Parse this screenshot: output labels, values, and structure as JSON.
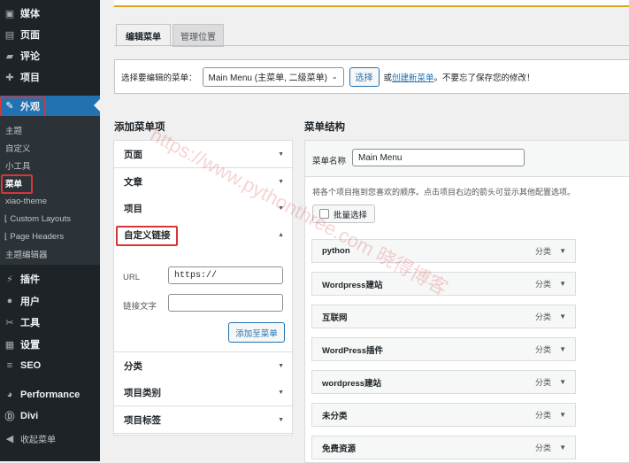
{
  "sidebar": {
    "top_items": [
      {
        "label": "媒体",
        "icon": "media-icon"
      },
      {
        "label": "页面",
        "icon": "page-icon"
      },
      {
        "label": "评论",
        "icon": "comment-icon"
      },
      {
        "label": "项目",
        "icon": "project-icon"
      }
    ],
    "active_item": {
      "label": "外观",
      "icon": "appearance-icon"
    },
    "submenu": [
      "主题",
      "自定义",
      "小工具",
      "菜单",
      "xiao-theme",
      "Custom Layouts",
      "Page Headers",
      "主题编辑器"
    ],
    "bottom_items": [
      {
        "label": "插件",
        "icon": "plugin-icon"
      },
      {
        "label": "用户",
        "icon": "user-icon"
      },
      {
        "label": "工具",
        "icon": "tool-icon"
      },
      {
        "label": "设置",
        "icon": "settings-icon"
      },
      {
        "label": "SEO",
        "icon": "seo-icon"
      },
      {
        "label": "Performance",
        "icon": "performance-icon"
      },
      {
        "label": "Divi",
        "icon": "divi-icon"
      },
      {
        "label": "收起菜单",
        "icon": "collapse-icon"
      }
    ]
  },
  "tabs": {
    "edit": "编辑菜单",
    "locations": "管理位置"
  },
  "select_bar": {
    "prompt": "选择要编辑的菜单：",
    "selected": "Main Menu (主菜单, 二级菜单)",
    "select_button": "选择",
    "or": "或",
    "create_link": "创建新菜单",
    "note": "。不要忘了保存您的修改！"
  },
  "add_items": {
    "heading": "添加菜单项",
    "rows": [
      "页面",
      "文章",
      "项目",
      "自定义链接",
      "分类",
      "项目类别",
      "项目标签"
    ],
    "custom_link": {
      "url_label": "URL",
      "url_value": "https://",
      "text_label": "链接文字",
      "text_value": "",
      "add_button": "添加至菜单"
    }
  },
  "structure": {
    "heading": "菜单结构",
    "name_label": "菜单名称",
    "name_value": "Main Menu",
    "hint": "将各个项目拖到您喜欢的顺序。点击项目右边的箭头可显示其他配置选项。",
    "bulk_select": "批量选择",
    "items": [
      {
        "title": "python",
        "type": "分类"
      },
      {
        "title": "Wordpress建站",
        "type": "分类"
      },
      {
        "title": "互联网",
        "type": "分类"
      },
      {
        "title": "WordPress插件",
        "type": "分类"
      },
      {
        "title": "wordpress建站",
        "type": "分类"
      },
      {
        "title": "未分类",
        "type": "分类"
      },
      {
        "title": "免费资源",
        "type": "分类"
      }
    ]
  },
  "watermark": "https://www.pythonthree.com  晓得博客",
  "colors": {
    "accent": "#2271b1",
    "sidebar_bg": "#1d2327",
    "highlight_red": "#d63638"
  }
}
